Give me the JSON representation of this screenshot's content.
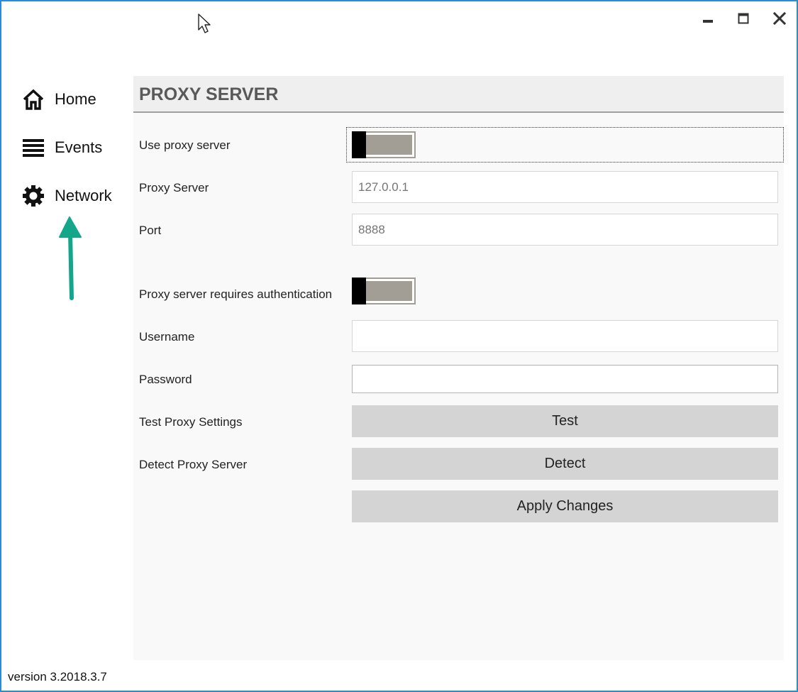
{
  "window": {
    "minimize_icon": "minimize-icon",
    "maximize_icon": "maximize-icon",
    "close_icon": "close-icon",
    "border_color": "#2b8cd6"
  },
  "sidebar": {
    "items": [
      {
        "label": "Home",
        "icon": "home-icon"
      },
      {
        "label": "Events",
        "icon": "list-icon"
      },
      {
        "label": "Network",
        "icon": "gear-icon"
      }
    ],
    "annotation_arrow_color": "#13a68a"
  },
  "panel": {
    "title": "PROXY SERVER",
    "use_proxy": {
      "label": "Use proxy server",
      "enabled": false
    },
    "proxy_server": {
      "label": "Proxy Server",
      "placeholder": "127.0.0.1",
      "value": ""
    },
    "port": {
      "label": "Port",
      "placeholder": "8888",
      "value": ""
    },
    "requires_auth": {
      "label": "Proxy server requires authentication",
      "enabled": false
    },
    "username": {
      "label": "Username",
      "value": ""
    },
    "password": {
      "label": "Password",
      "value": ""
    },
    "test": {
      "label": "Test Proxy Settings",
      "button": "Test"
    },
    "detect": {
      "label": "Detect Proxy Server",
      "button": "Detect"
    },
    "apply_button": "Apply Changes"
  },
  "footer": {
    "version": "version 3.2018.3.7"
  }
}
